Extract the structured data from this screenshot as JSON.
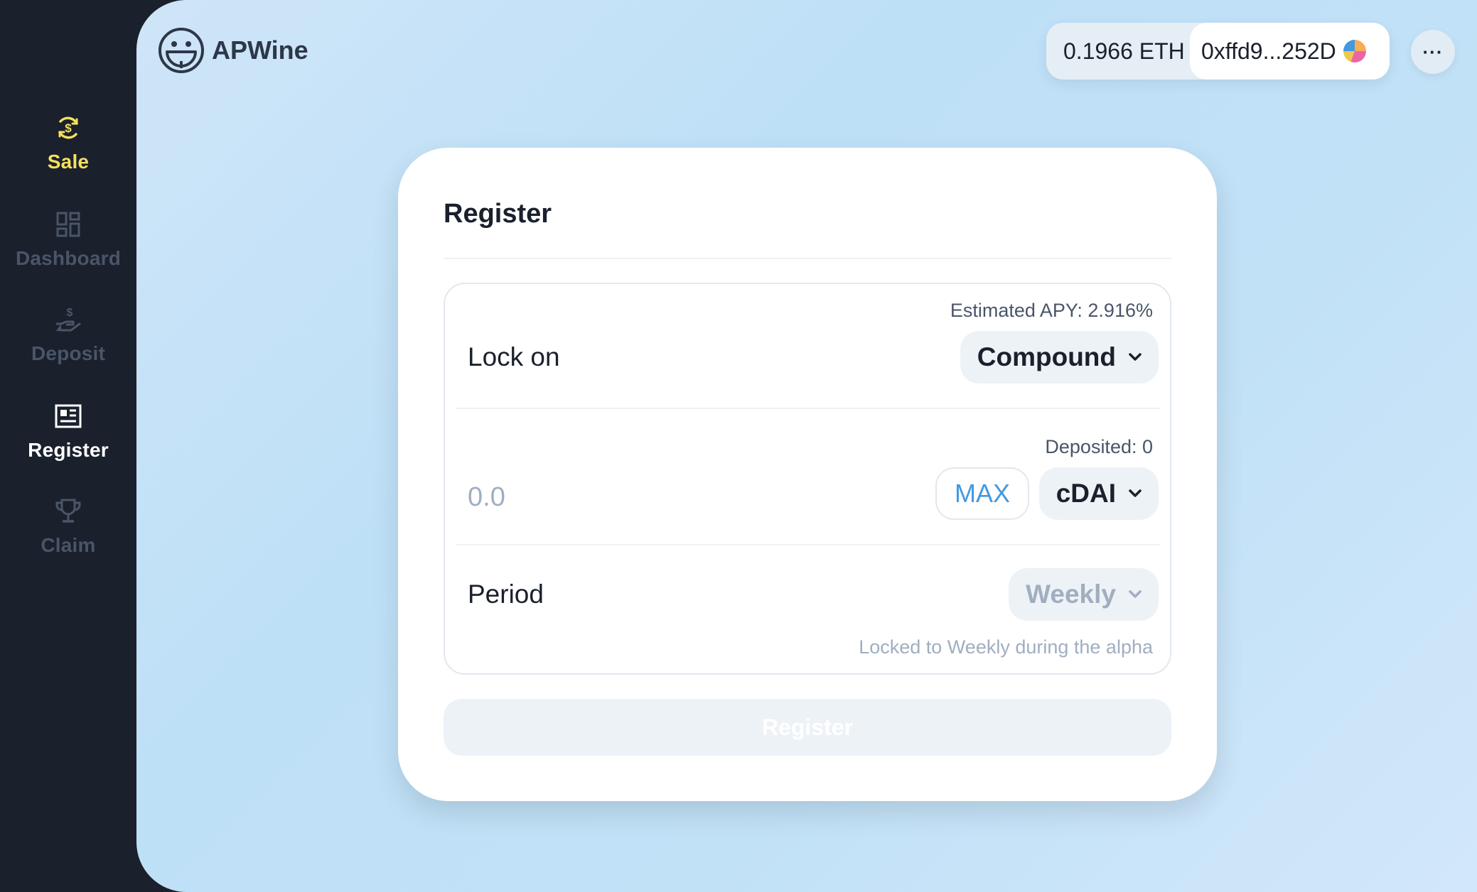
{
  "sidebar": {
    "items": [
      {
        "label": "Sale",
        "icon": "dollar-cycle-icon",
        "state": "active",
        "color": "#f6e05e"
      },
      {
        "label": "Dashboard",
        "icon": "dashboard-icon",
        "state": "inactive",
        "color": "#4a5568"
      },
      {
        "label": "Deposit",
        "icon": "hand-dollar-icon",
        "state": "inactive",
        "color": "#4a5568"
      },
      {
        "label": "Register",
        "icon": "newspaper-icon",
        "state": "current",
        "color": "#ffffff"
      },
      {
        "label": "Claim",
        "icon": "trophy-icon",
        "state": "inactive",
        "color": "#4a5568"
      }
    ]
  },
  "header": {
    "brand": "APWine",
    "balance": "0.1966 ETH",
    "address": "0xffd9...252D",
    "more_label": "···"
  },
  "card": {
    "title": "Register",
    "lock": {
      "label": "Lock on",
      "apy_hint": "Estimated APY: 2.916%",
      "selected": "Compound"
    },
    "amount": {
      "placeholder": "0.0",
      "deposited_hint": "Deposited: 0",
      "max_label": "MAX",
      "token": "cDAI"
    },
    "period": {
      "label": "Period",
      "selected": "Weekly",
      "note": "Locked to Weekly during the alpha"
    },
    "submit_label": "Register"
  },
  "colors": {
    "sidebar_bg": "#1a202c",
    "accent_yellow": "#f6e05e",
    "link_blue": "#4299e1",
    "muted": "#a0aec0"
  }
}
